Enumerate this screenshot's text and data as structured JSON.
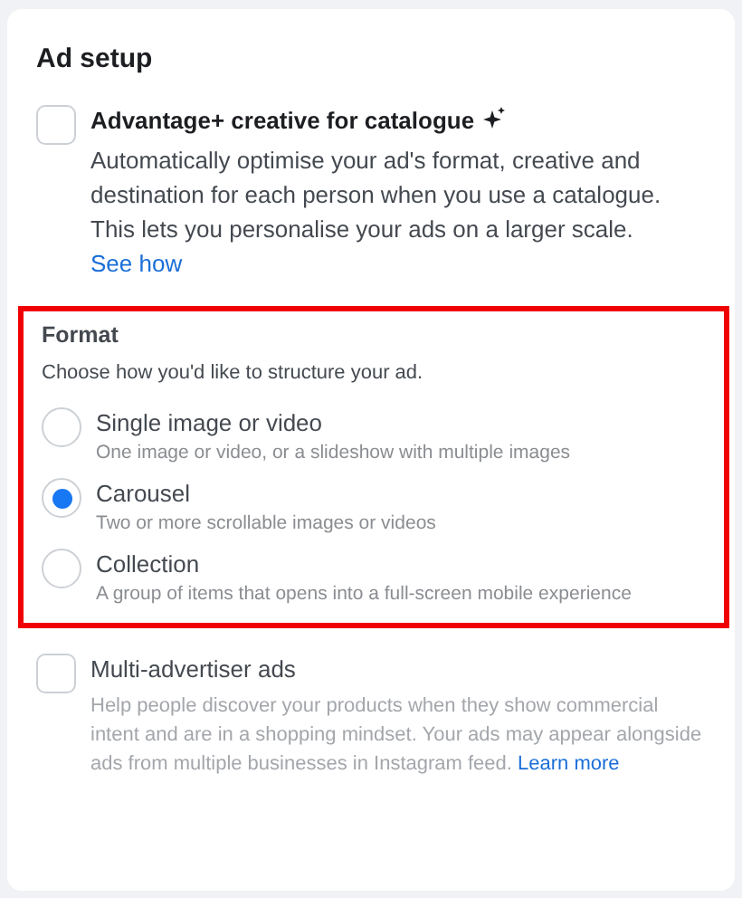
{
  "card": {
    "title": "Ad setup"
  },
  "advantage": {
    "label": "Advantage+ creative for catalogue",
    "checked": false,
    "description": "Automatically optimise your ad's format, creative and destination for each person when you use a catalogue. This lets you personalise your ads on a larger scale.",
    "link": "See how"
  },
  "format": {
    "highlighted": true,
    "title": "Format",
    "description": "Choose how you'd like to structure your ad.",
    "options": [
      {
        "label": "Single image or video",
        "description": "One image or video, or a slideshow with multiple images",
        "selected": false
      },
      {
        "label": "Carousel",
        "description": "Two or more scrollable images or videos",
        "selected": true
      },
      {
        "label": "Collection",
        "description": "A group of items that opens into a full-screen mobile experience",
        "selected": false
      }
    ]
  },
  "multi_advertiser": {
    "label": "Multi-advertiser ads",
    "checked": false,
    "description": "Help people discover your products when they show commercial intent and are in a shopping mindset. Your ads may appear alongside ads from multiple businesses in Instagram feed.",
    "link": "Learn more"
  }
}
